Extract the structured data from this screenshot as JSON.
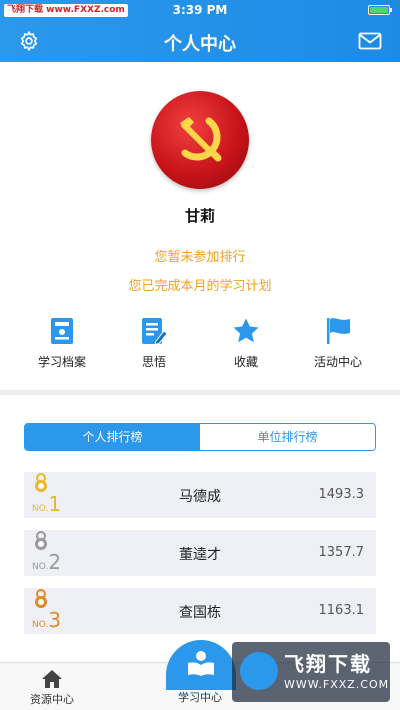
{
  "status_bar": {
    "watermark": "飞翔下载 www.FXXZ.com",
    "time": "3:39 PM"
  },
  "header": {
    "title": "个人中心",
    "settings_icon": "gear-icon",
    "mail_icon": "mail-icon"
  },
  "profile": {
    "avatar_icon": "party-emblem-icon",
    "name": "甘莉",
    "rank_message": "您暂未参加排行",
    "plan_message": "您已完成本月的学习计划"
  },
  "quick_menu": [
    {
      "label": "学习档案",
      "icon": "archive-icon"
    },
    {
      "label": "思悟",
      "icon": "note-edit-icon"
    },
    {
      "label": "收藏",
      "icon": "star-icon"
    },
    {
      "label": "活动中心",
      "icon": "flag-icon"
    }
  ],
  "ranking_tabs": [
    {
      "label": "个人排行榜",
      "active": true
    },
    {
      "label": "单位排行榜",
      "active": false
    }
  ],
  "ranking": [
    {
      "no_prefix": "NO.",
      "rank": "1",
      "name": "马德成",
      "score": "1493.3",
      "color": "#e8b92a"
    },
    {
      "no_prefix": "NO.",
      "rank": "2",
      "name": "董逵才",
      "score": "1357.7",
      "color": "#9a9a9a"
    },
    {
      "no_prefix": "NO.",
      "rank": "3",
      "name": "查国栋",
      "score": "1163.1",
      "color": "#e08a2c"
    }
  ],
  "bottom_nav": [
    {
      "label": "资源中心",
      "icon": "home-icon"
    },
    {
      "label": "学习中心",
      "icon": "book-icon"
    }
  ],
  "watermark": {
    "title": "飞翔下载",
    "url": "WWW.FXXZ.COM"
  },
  "colors": {
    "primary": "#2c98ec",
    "accent_text": "#f0a020"
  }
}
